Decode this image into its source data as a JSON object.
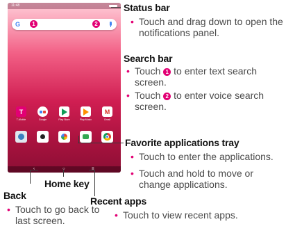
{
  "phone": {
    "status_time": "11:48",
    "search_badge_1": "1",
    "search_badge_2": "2",
    "apps": [
      {
        "label": "T-Mobile",
        "icon": "t-mobile-icon"
      },
      {
        "label": "Google",
        "icon": "google-folder-icon"
      },
      {
        "label": "Play Store",
        "icon": "play-store-icon"
      },
      {
        "label": "Play Music",
        "icon": "play-music-icon"
      },
      {
        "label": "Gmail",
        "icon": "gmail-icon"
      }
    ],
    "tray": [
      "phone-icon",
      "camera-icon",
      "gallery-icon",
      "messages-icon",
      "chrome-icon"
    ],
    "nav": {
      "back": "‹",
      "home": "○",
      "recent": "≡"
    }
  },
  "callouts": {
    "status_bar": {
      "heading": "Status bar",
      "bullets": [
        "Touch and drag down to open the notifications panel."
      ]
    },
    "search_bar": {
      "heading": "Search bar",
      "bullet1_pre": "Touch ",
      "bullet1_num": "1",
      "bullet1_post": " to enter text search screen.",
      "bullet2_pre": "Touch ",
      "bullet2_num": "2",
      "bullet2_post": " to enter voice search screen."
    },
    "favorites_tray": {
      "heading": "Favorite applications tray",
      "bullets": [
        "Touch to enter the applications.",
        "Touch and hold to move or change applications."
      ]
    },
    "home_key": {
      "heading": "Home key"
    },
    "back": {
      "heading": "Back",
      "bullet": "Touch to go back to last screen."
    },
    "recent_apps": {
      "heading": "Recent apps",
      "bullet": "Touch to view recent apps."
    }
  },
  "colors": {
    "accent": "#e20074",
    "heading": "#111111",
    "body": "#4a4a4a"
  }
}
